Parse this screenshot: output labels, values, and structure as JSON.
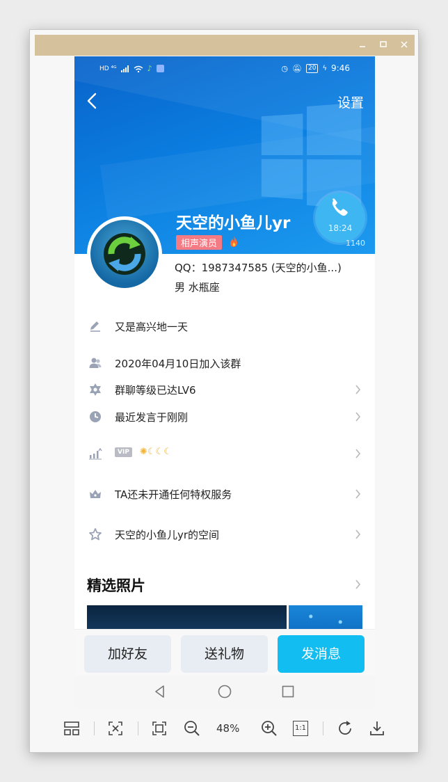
{
  "statusbar": {
    "left_indicators": "HD ⁴ᴳ",
    "battery": "20",
    "time": "9:46"
  },
  "header": {
    "settings_label": "设置"
  },
  "profile": {
    "nickname": "天空的小鱼儿yr",
    "tag": "相声演员",
    "call_time": "18:24",
    "call_extra": "1140",
    "qq_line": "QQ：1987347585 (天空的小鱼...)",
    "sex_line": "男  水瓶座"
  },
  "rows": [
    {
      "icon": "pencil-icon",
      "label": "又是高兴地一天",
      "chevron": false
    },
    {
      "icon": "group-icon",
      "label": "2020年04月10日加入该群",
      "chevron": false
    },
    {
      "icon": "star-of-david-icon",
      "label": "群聊等级已达LV6",
      "chevron": true
    },
    {
      "icon": "clock-icon",
      "label": "最近发言于刚刚",
      "chevron": true
    },
    {
      "icon": "level-chart-icon",
      "label": "VIP",
      "chevron": true
    },
    {
      "icon": "crown-icon",
      "label": "TA还未开通任何特权服务",
      "chevron": true
    },
    {
      "icon": "star-outline-icon",
      "label": "天空的小鱼儿yr的空间",
      "chevron": true
    }
  ],
  "photos": {
    "title": "精选照片"
  },
  "actions": {
    "add_friend": "加好友",
    "send_gift": "送礼物",
    "send_message": "发消息"
  },
  "viewer": {
    "zoom": "48%",
    "one_to_one": "1:1"
  },
  "colors": {
    "accent": "#12bdf2",
    "hero": "#0b7de0",
    "tag": "#f47a84",
    "titlebar": "#d5c19b"
  }
}
